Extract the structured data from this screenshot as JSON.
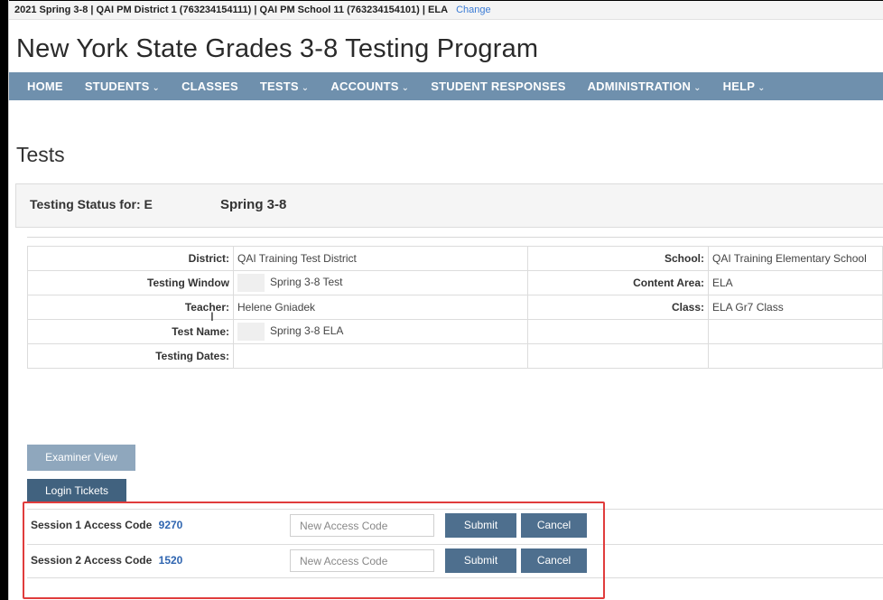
{
  "context_bar": {
    "text": "2021 Spring 3-8  | QAI PM District 1 (763234154111)  | QAI PM School 11 (763234154101)  | ELA",
    "change_link": "Change"
  },
  "app": {
    "title": "New York State Grades 3-8 Testing Program"
  },
  "nav": {
    "items": [
      {
        "label": "HOME",
        "dropdown": false
      },
      {
        "label": "STUDENTS",
        "dropdown": true
      },
      {
        "label": "CLASSES",
        "dropdown": false
      },
      {
        "label": "TESTS",
        "dropdown": true
      },
      {
        "label": "ACCOUNTS",
        "dropdown": true
      },
      {
        "label": "STUDENT RESPONSES",
        "dropdown": false
      },
      {
        "label": "ADMINISTRATION",
        "dropdown": true
      },
      {
        "label": "HELP",
        "dropdown": true
      }
    ],
    "chevron": "⌄"
  },
  "page": {
    "heading": "Tests"
  },
  "status": {
    "label": "Testing Status for: E",
    "value": "Spring 3-8"
  },
  "info": {
    "district_label": "District:",
    "district_value": "QAI Training Test District",
    "school_label": "School:",
    "school_value": "QAI Training Elementary School",
    "window_label": "Testing Window",
    "window_value": "Spring 3-8 Test",
    "content_label": "Content Area:",
    "content_value": "ELA",
    "teacher_label": "Teacher:",
    "teacher_value": "Helene Gniadek",
    "class_label": "Class:",
    "class_value": "ELA Gr7 Class",
    "testname_label": "Test Name:",
    "testname_value": "Spring 3-8 ELA",
    "dates_label": "Testing Dates:",
    "dates_value": ""
  },
  "buttons": {
    "examiner": "Examiner View",
    "login": "Login Tickets"
  },
  "sessions": [
    {
      "label": "Session 1 Access Code",
      "code": "9270",
      "placeholder": "New Access Code",
      "submit": "Submit",
      "cancel": "Cancel"
    },
    {
      "label": "Session 2 Access Code",
      "code": "1520",
      "placeholder": "New Access Code",
      "submit": "Submit",
      "cancel": "Cancel"
    }
  ],
  "colors": {
    "nav": "#6f90ad",
    "button": "#4e6f8e",
    "highlight": "#e03c3c",
    "code": "#2f65b0"
  }
}
